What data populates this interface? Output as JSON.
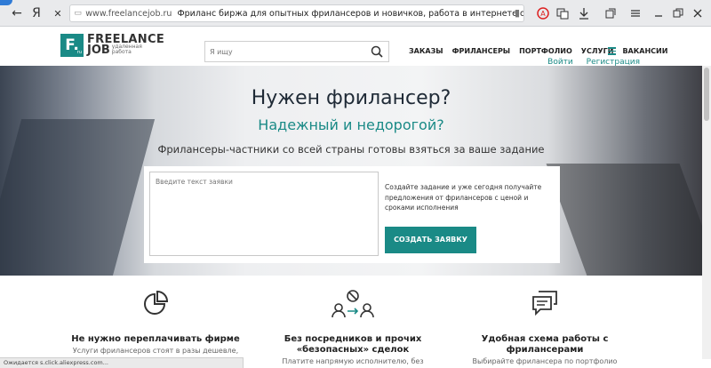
{
  "browser": {
    "url": "www.freelancejob.ru",
    "tab_title": "Фриланс биржа для опытных фрилансеров и новичков, работа в интернете от...",
    "back_glyph": "←",
    "yandex_glyph": "Я",
    "close_glyph": "✕",
    "status_text": "Ожидается s.click.aliexpress.com..."
  },
  "header": {
    "logo_letter": "F.",
    "logo_sub": "ru",
    "logo_line1": "FREELANCE",
    "logo_line2": "JOB",
    "logo_tagline": "удаленная работа",
    "search_placeholder": "Я ищу",
    "login": "Войти",
    "register": "Регистрация",
    "nav": [
      "ЗАКАЗЫ",
      "ФРИЛАНСЕРЫ",
      "ПОРТФОЛИО",
      "УСЛУГИ",
      "ВАКАНСИИ"
    ]
  },
  "hero": {
    "title": "Нужен фрилансер?",
    "subtitle": "Надежный и недорогой?",
    "description": "Фрилансеры-частники со всей страны готовы взяться за ваше задание",
    "textarea_placeholder": "Введите текст заявки",
    "note": "Создайте задание и уже сегодня получайте предложения от фрилансеров с ценой и сроками исполнения",
    "button": "СОЗДАТЬ ЗАЯВКУ"
  },
  "features": [
    {
      "title": "Не нужно переплачивать фирме",
      "text": "Услуги фрилансеров стоят в разы дешевле,"
    },
    {
      "title": "Без посредников и прочих «безопасных» сделок",
      "text": "Платите напрямую исполнителю, без"
    },
    {
      "title": "Удобная схема работы с фрилансерами",
      "text": "Выбирайте фрилансера по портфолио"
    }
  ],
  "colors": {
    "accent": "#1a8a86"
  }
}
